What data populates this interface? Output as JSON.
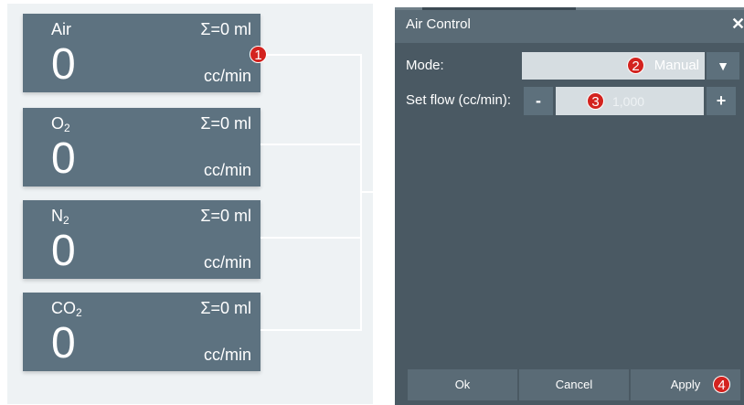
{
  "gas_cards": [
    {
      "name": "Air",
      "subscript": "",
      "total": "Σ=0 ml",
      "value": "0",
      "unit": "cc/min"
    },
    {
      "name": "O",
      "subscript": "2",
      "total": "Σ=0 ml",
      "value": "0",
      "unit": "cc/min"
    },
    {
      "name": "N",
      "subscript": "2",
      "total": "Σ=0 ml",
      "value": "0",
      "unit": "cc/min"
    },
    {
      "name": "CO",
      "subscript": "2",
      "total": "Σ=0 ml",
      "value": "0",
      "unit": "cc/min"
    }
  ],
  "callouts": {
    "one": "1",
    "two": "2",
    "three": "3",
    "four": "4"
  },
  "dialog": {
    "title": "Air Control",
    "close_glyph": "✕",
    "mode_label": "Mode:",
    "mode_value": "Manual",
    "dropdown_glyph": "▼",
    "flow_label": "Set flow (cc/min):",
    "minus_label": "-",
    "plus_label": "+",
    "flow_placeholder": "1,000",
    "ok_label": "Ok",
    "cancel_label": "Cancel",
    "apply_label": "Apply"
  },
  "colors": {
    "card": "#5d7280",
    "dialog_bg": "#4a5963",
    "dialog_header": "#5a6b76",
    "field": "#d6dde1",
    "callout": "#d3231f"
  }
}
